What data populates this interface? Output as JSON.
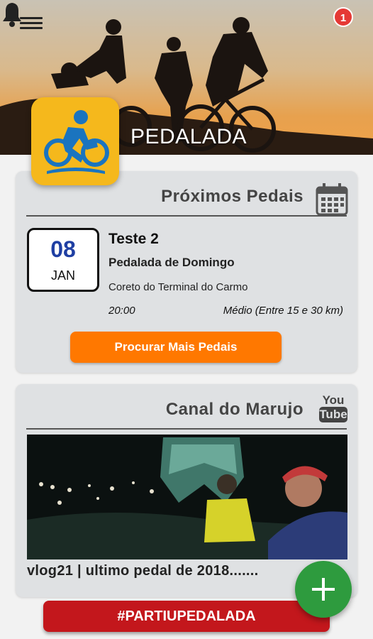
{
  "app": {
    "title": "PEDALADA",
    "notification_count": "1"
  },
  "icons": {
    "menu": "menu-icon",
    "bell": "bell-icon",
    "calendar": "calendar-icon",
    "youtube": "youtube-icon",
    "add": "plus-icon",
    "logo": "cyclist-icon"
  },
  "colors": {
    "logo_bg": "#f5b81c",
    "accent_orange": "#ff7800",
    "red_button": "#c3171c",
    "fab_green": "#2e9b3e",
    "date_blue": "#1f3fa3"
  },
  "upcoming": {
    "title": "Próximos Pedais",
    "event": {
      "day": "08",
      "month": "JAN",
      "name": "Teste 2",
      "subtitle": "Pedalada de Domingo",
      "place": "Coreto do Terminal do Carmo",
      "time": "20:00",
      "level": "Médio (Entre 15 e 30 km)"
    },
    "more_button": "Procurar Mais Pedais"
  },
  "channel": {
    "title": "Canal do Marujo",
    "youtube_top": "You",
    "youtube_bottom": "Tube",
    "video_title": "vlog21 | ultimo pedal de 2018......."
  },
  "bottom_button": "#PARTIUPEDALADA"
}
